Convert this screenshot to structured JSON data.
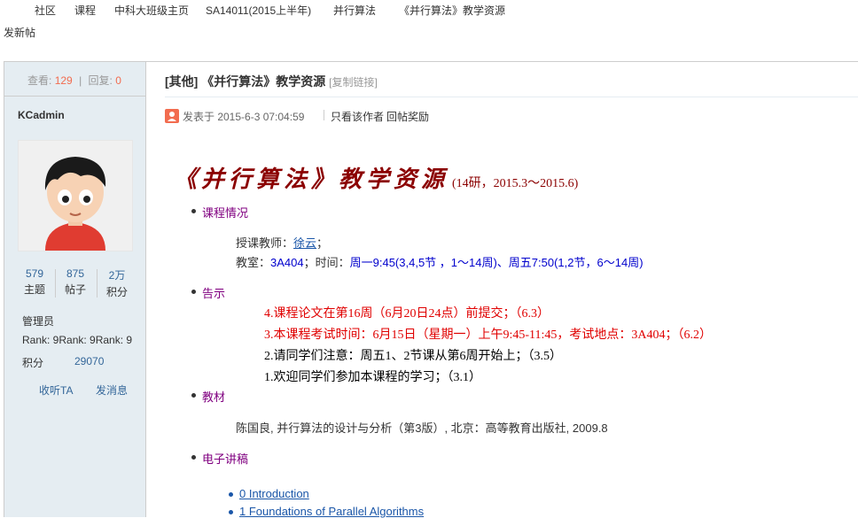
{
  "nav": {
    "items": [
      "社区",
      "课程",
      "中科大班级主页",
      "SA14011(2015上半年)",
      "并行算法",
      "《并行算法》教学资源"
    ]
  },
  "new_post": "发新帖",
  "sidebar": {
    "views_label": "查看:",
    "views": "129",
    "replies_label": "回复:",
    "replies": "0",
    "author": "KCadmin",
    "counts": [
      {
        "value": "579",
        "label": "主题"
      },
      {
        "value": "875",
        "label": "帖子"
      },
      {
        "value": "2万",
        "label": "积分"
      }
    ],
    "group": "管理员",
    "rank_text": "Rank: 9Rank: 9Rank: 9",
    "points_label": "积分",
    "points": "29070",
    "follow": "收听TA",
    "message": "发消息"
  },
  "post": {
    "title": "[其他] 《并行算法》教学资源",
    "copy_link": "[复制链接]",
    "posted_at": "发表于 2015-6-3 07:04:59",
    "author_only": "只看该作者",
    "reward": "回帖奖励",
    "big_title": "《并行算法》教学资源",
    "big_subtitle": "(14研，2015.3～2015.6)",
    "sections": {
      "course_info": "课程情况",
      "notice": "告示",
      "textbook": "教材",
      "slides": "电子讲稿"
    },
    "teacher_label": "授课教师：",
    "teacher_name": "徐云",
    "teacher_end": "；",
    "room_label": "教室：",
    "room": "3A404",
    "time_label": "；时间：",
    "time": "周一9:45(3,4,5节 ，1～14周)、周五7:50(1,2节，6～14周)",
    "notices": [
      {
        "text": "4.课程论文在第16周（6月20日24点）前提交；（6.3）",
        "color": "red"
      },
      {
        "text": "3.本课程考试时间：6月15日（星期一）上午9:45-11:45，考试地点：3A404；（6.2）",
        "color": "red"
      },
      {
        "text": "2.请同学们注意：周五1、2节课从第6周开始上；（3.5）",
        "color": "black"
      },
      {
        "text": "1.欢迎同学们参加本课程的学习；（3.1）",
        "color": "black"
      }
    ],
    "textbook": "陈国良, 并行算法的设计与分析（第3版）, 北京：高等教育出版社, 2009.8",
    "slides": [
      "0 Introduction",
      "1 Foundations of Parallel Algorithms"
    ]
  }
}
